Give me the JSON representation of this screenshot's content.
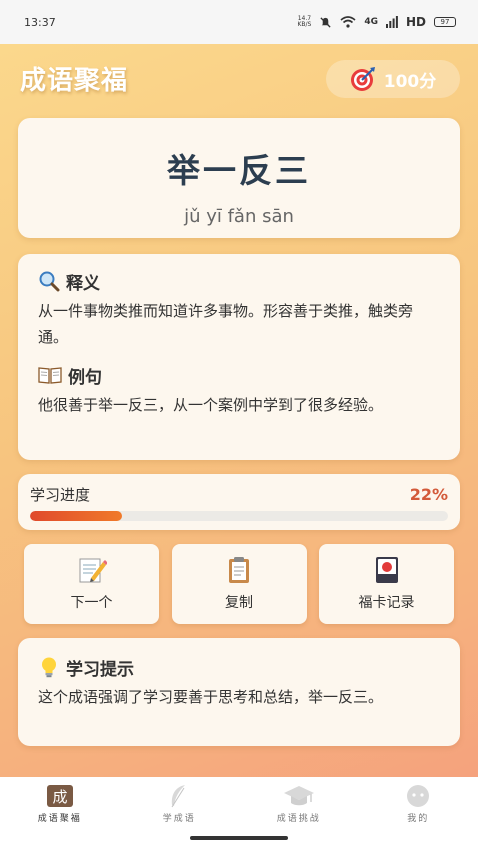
{
  "status_bar": {
    "time": "13:37",
    "speed_value": "14.7",
    "speed_unit": "KB/S",
    "network": "4G",
    "hd": "HD",
    "battery": "97"
  },
  "header": {
    "app_title": "成语聚福",
    "score": "100分",
    "score_icon": "target-icon"
  },
  "idiom": {
    "text": "举一反三",
    "pinyin": "jǔ yī fǎn sān"
  },
  "meaning": {
    "title": "释义",
    "title_icon": "magnifier-icon",
    "text": "从一件事物类推而知道许多事物。形容善于类推，触类旁通。"
  },
  "example": {
    "title": "例句",
    "title_icon": "book-icon",
    "text": "他很善于举一反三，从一个案例中学到了很多经验。"
  },
  "progress": {
    "label": "学习进度",
    "percent_text": "22%",
    "value": 0.22
  },
  "actions": [
    {
      "label": "下一个",
      "icon": "memo-icon"
    },
    {
      "label": "复制",
      "icon": "clipboard-icon"
    },
    {
      "label": "福卡记录",
      "icon": "card-icon"
    }
  ],
  "tip": {
    "title": "学习提示",
    "title_icon": "lightbulb-icon",
    "text": "这个成语强调了学习要善于思考和总结，举一反三。"
  },
  "tabs": [
    {
      "label": "成语聚福",
      "icon": "idiom-tab-icon",
      "active": true
    },
    {
      "label": "学成语",
      "icon": "feather-icon",
      "active": false
    },
    {
      "label": "成语挑战",
      "icon": "graduation-cap-icon",
      "active": false
    },
    {
      "label": "我的",
      "icon": "profile-icon",
      "active": false
    }
  ],
  "colors": {
    "gradient_top": "#fbd88c",
    "gradient_bottom": "#f5a27d",
    "progress_fill": "#e04a2c",
    "percent_text": "#d35a3a",
    "idiom_text": "#2c3e50",
    "card_bg": "#fdf7ee"
  }
}
